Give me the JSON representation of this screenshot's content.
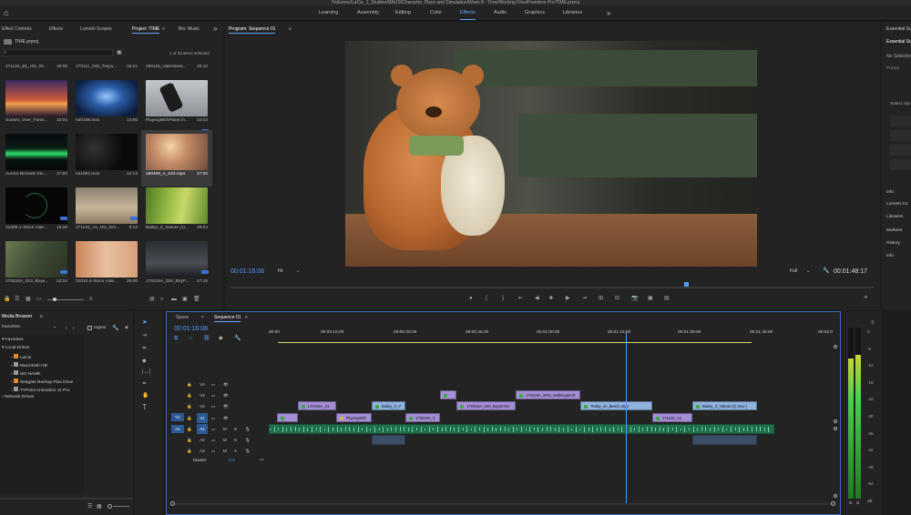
{
  "titlebar": {
    "text": "/Volumes/LaCie_1_Studies/MAUS/Character, Place and Simulation/Week 8 - Time/Working Files/Premiere Pro/TIME.prproj"
  },
  "workspaces": [
    "Learning",
    "Assembly",
    "Editing",
    "Color",
    "Effects",
    "Audio",
    "Graphics",
    "Libraries"
  ],
  "workspaces_active": "Effects",
  "workspaces_more": "»",
  "left_tabs": [
    "Effect Controls",
    "Effects",
    "Lumetri Scopes",
    "Project: TIME",
    "Bin: Music"
  ],
  "left_tabs_more": "»",
  "project": {
    "file": "TIME.prproj",
    "selection": "1 of 33 items selected",
    "top_row": [
      {
        "name": "171124_B1_HD_00...",
        "dur": "19:05"
      },
      {
        "name": "170111_049_Tokyo...",
        "dur": "15:21"
      },
      {
        "name": "190126_Valentines...",
        "dur": "25:10"
      }
    ],
    "items": [
      {
        "name": "Sunset_Over_Famil...",
        "dur": "10:04"
      },
      {
        "name": "hd0198.mov",
        "dur": "14:05"
      },
      {
        "name": "PlayingWithPlane.m...",
        "dur": "10:02"
      },
      {
        "name": "Aurora Borealis Sto...",
        "dur": "17:00"
      },
      {
        "name": "hd1992.mov",
        "dur": "14:12"
      },
      {
        "name": "160409_A_023.mp4",
        "dur": "17:02"
      },
      {
        "name": "31005-1-Stock Vide...",
        "dur": "19:25"
      },
      {
        "name": "171124_A1_HD_021...",
        "dur": "9:12"
      },
      {
        "name": "Bailey_3_Videos (1)...",
        "dur": "29:04"
      },
      {
        "name": "170216A_013_Boya...",
        "dur": "24:24"
      },
      {
        "name": "31010-2-Stock Vide...",
        "dur": "25:00"
      },
      {
        "name": "170216A_016_BoyP...",
        "dur": "17:15"
      }
    ]
  },
  "program": {
    "title": "Program: Sequence 01",
    "timecode": "00:01:16:08",
    "fit": "Fit",
    "quality": "Full",
    "duration": "00:01:48:17",
    "playhead_fraction": 0.705
  },
  "right_panel": {
    "tab": "Essential Sound",
    "header": "Essential So",
    "no_selection": "No Selection",
    "preset": "Preset",
    "select_clip": "Select clip",
    "items": [
      "Info",
      "Lumetri Co",
      "Libraries",
      "Markers",
      "History",
      "Info"
    ]
  },
  "media_browser": {
    "title": "Media Browser",
    "favorites_select": "Favorites",
    "ingest": "Ingest",
    "tree": [
      {
        "label": "Favorites",
        "level": 0
      },
      {
        "label": "Local Drives",
        "level": 0
      },
      {
        "label": "LaCie",
        "level": 2
      },
      {
        "label": "Macintosh HD",
        "level": 2
      },
      {
        "label": "NO NAME",
        "level": 2
      },
      {
        "label": "Seagate Backup Plus Drive",
        "level": 2
      },
      {
        "label": "TVPaint Animation 11 Pro",
        "level": 2
      },
      {
        "label": "Network Drives",
        "level": 0
      }
    ]
  },
  "timeline": {
    "tabs": [
      "Space",
      "Sequence 01"
    ],
    "active_tab": "Sequence 01",
    "timecode": "00:01:16:08",
    "ruler": [
      "00:00",
      "00:00:15:00",
      "00:00:30:00",
      "00:00:45:00",
      "00:01:00:00",
      "00:01:15:00",
      "00:01:30:00",
      "00:01:45:00",
      "00:02:0"
    ],
    "tracks_video": [
      "V4",
      "V3",
      "V2",
      "V1"
    ],
    "tracks_audio": [
      "A1",
      "A2",
      "A3"
    ],
    "source_v": "V1",
    "source_a": "A1",
    "master": "Master",
    "master_val": "0.0",
    "track_letters": {
      "m": "M",
      "s": "S"
    },
    "clips": [
      {
        "track": "V3",
        "label": "170216A_0PM_WalkingIntoR",
        "start": 0.437,
        "end": 0.552,
        "kind": "v"
      },
      {
        "track": "V3",
        "label": "",
        "start": 0.304,
        "end": 0.332,
        "kind": "v"
      },
      {
        "track": "V2",
        "label": "170216A_01",
        "start": 0.051,
        "end": 0.119,
        "kind": "v"
      },
      {
        "track": "V2",
        "label": "Bailey_3_V",
        "start": 0.182,
        "end": 0.242,
        "kind": "b"
      },
      {
        "track": "V2",
        "label": "170216A_030_BoyOnN2",
        "start": 0.333,
        "end": 0.437,
        "kind": "v"
      },
      {
        "track": "V2",
        "label": "Teddy_on_Bench.mp4",
        "start": 0.552,
        "end": 0.679,
        "kind": "b"
      },
      {
        "track": "V2",
        "label": "Bailey_3_Videos (1).mov [",
        "start": 0.75,
        "end": 0.865,
        "kind": "b"
      },
      {
        "track": "V1",
        "label": "",
        "start": 0.015,
        "end": 0.051,
        "kind": "v"
      },
      {
        "track": "V1",
        "label": "PlayingWith",
        "start": 0.119,
        "end": 0.182,
        "kind": "fx"
      },
      {
        "track": "V1",
        "label": "170216A_0",
        "start": 0.242,
        "end": 0.304,
        "kind": "v"
      },
      {
        "track": "V1",
        "label": "171124_A1",
        "start": 0.679,
        "end": 0.75,
        "kind": "v"
      }
    ],
    "playhead_fraction": 0.632
  },
  "meter": {
    "scale": [
      "0",
      "-6",
      "-12",
      "-18",
      "-24",
      "-30",
      "-36",
      "-42",
      "-48",
      "-54",
      "dB"
    ],
    "solo": [
      "S",
      "S"
    ],
    "level_left": 0.82,
    "level_right": 0.84
  }
}
